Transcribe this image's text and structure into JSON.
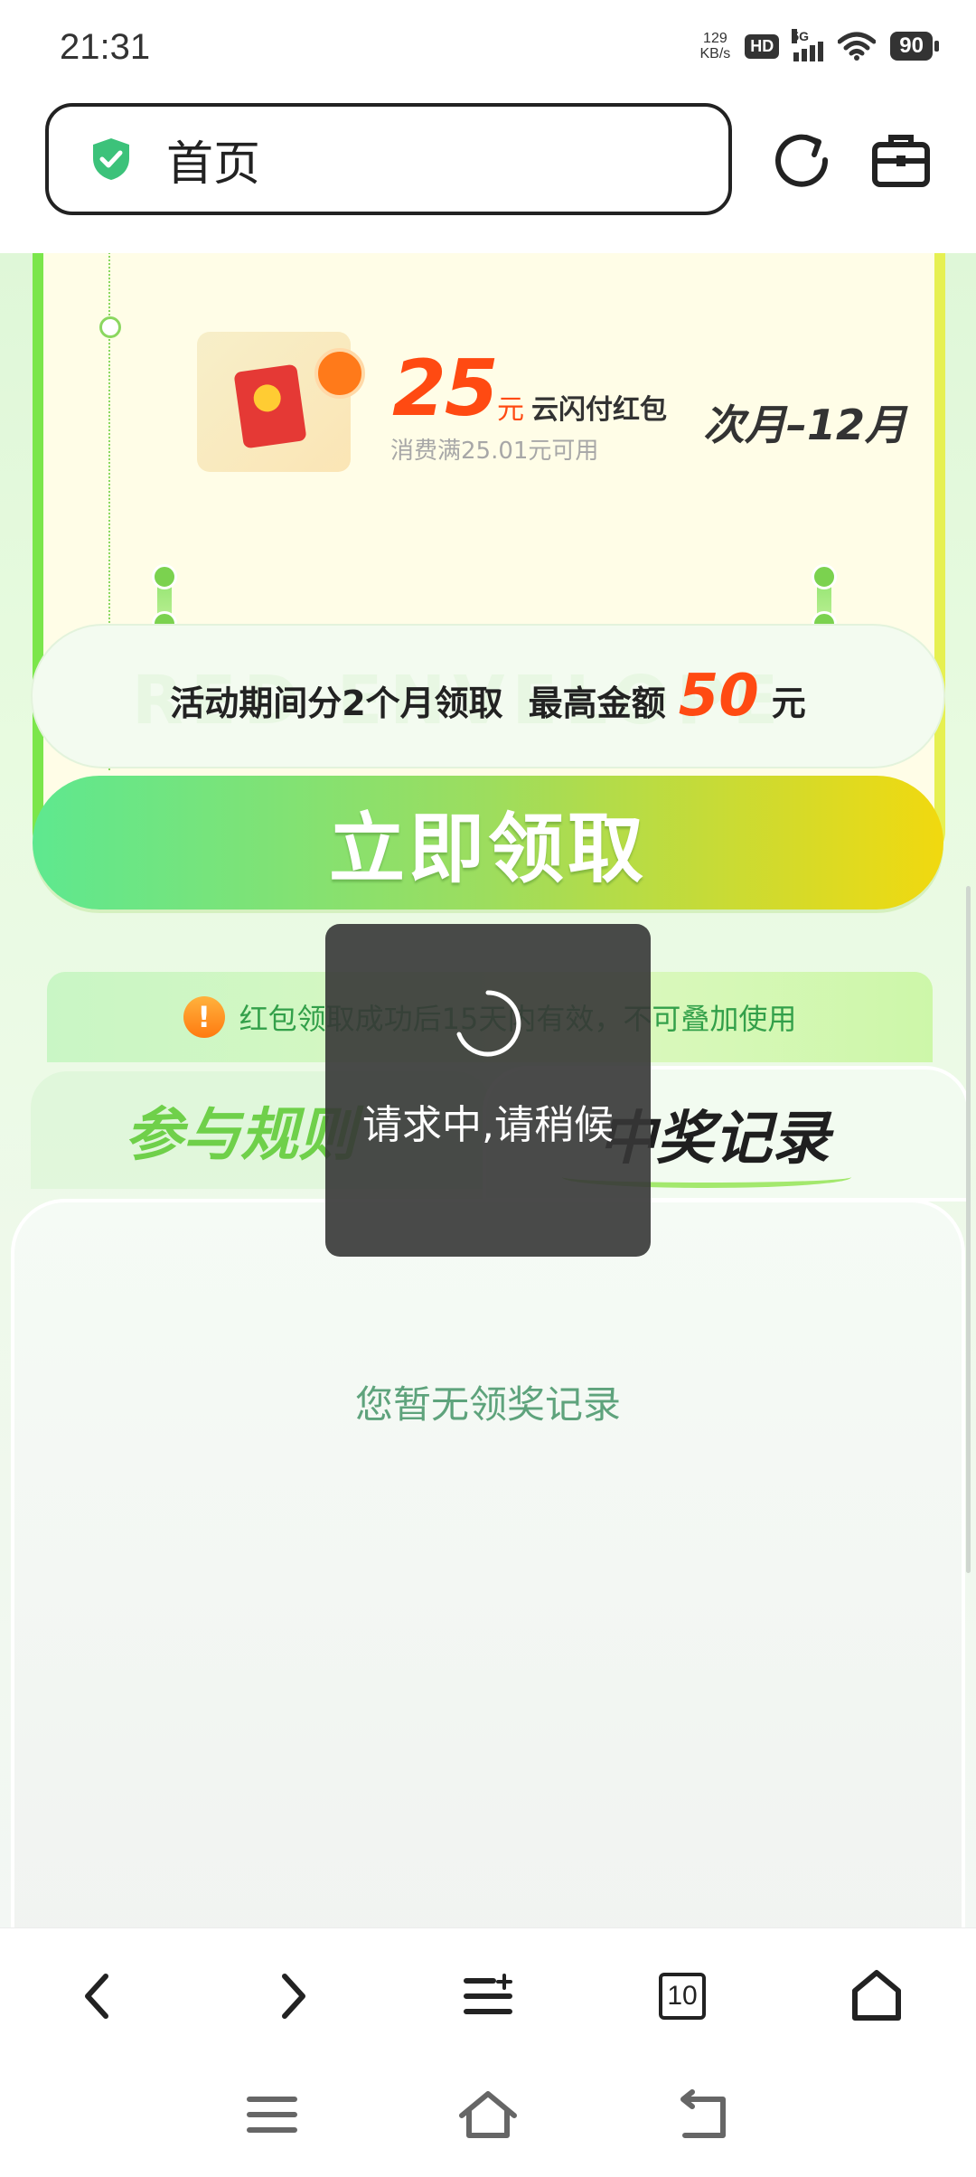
{
  "status_bar": {
    "time": "21:31",
    "net_speed_value": "129",
    "net_speed_unit": "KB/s",
    "hd_label": "HD",
    "network_label": "5G",
    "battery": "90"
  },
  "browser": {
    "url_text": "首页",
    "tabs_count": "10"
  },
  "voucher": {
    "amount": "25",
    "unit": "元",
    "label": "云闪付红包",
    "condition": "消费满25.01元可用",
    "period": "次月–12月"
  },
  "info": {
    "text": "活动期间分2个月领取",
    "max_label": "最高金额",
    "max_value": "50",
    "max_unit": "元",
    "watermark": "RED ENVELOPE"
  },
  "claim_button": "立即领取",
  "notice": "红包领取成功后15天内有效，不可叠加使用",
  "tabs": {
    "rules": "参与规则",
    "records": "中奖记录"
  },
  "records_empty": "您暂无领奖记录",
  "loading": "请求中,请稍候",
  "colors": {
    "accent_green": "#7be64b",
    "amount_red": "#ff4a12",
    "claim_start": "#5ee88f",
    "claim_end": "#f1d90f",
    "empty_text": "#5ea37c"
  },
  "icons": {
    "shield": "shield-check-icon",
    "refresh": "refresh-icon",
    "toolbox": "toolbox-icon",
    "back": "chevron-left-icon",
    "forward": "chevron-right-icon",
    "menu": "menu-icon",
    "home": "home-icon"
  }
}
